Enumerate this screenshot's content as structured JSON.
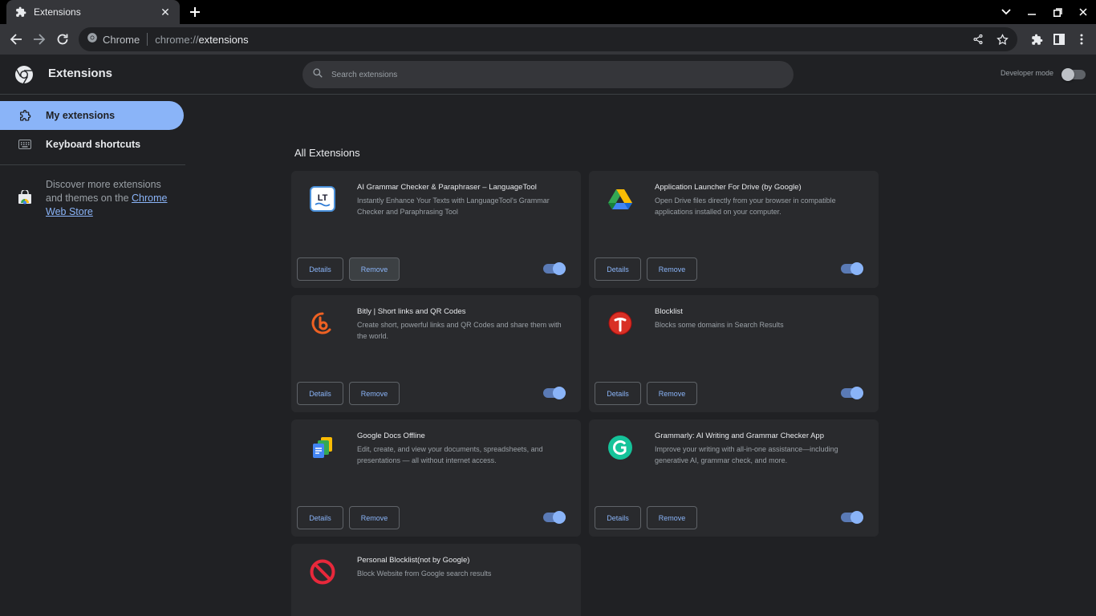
{
  "browser": {
    "tab_title": "Extensions",
    "new_tab_label": "+",
    "site_chip": "Chrome",
    "url_scheme": "chrome://",
    "url_host": "extensions"
  },
  "header": {
    "title": "Extensions",
    "search_placeholder": "Search extensions",
    "developer_mode_label": "Developer mode",
    "developer_mode_on": false
  },
  "sidebar": {
    "items": [
      {
        "label": "My extensions",
        "active": true
      },
      {
        "label": "Keyboard shortcuts",
        "active": false
      }
    ],
    "discover_text_1": "Discover more extensions and themes on the ",
    "discover_link_1": "Chrome",
    "discover_link_2": "Web Store"
  },
  "main": {
    "section_title": "All Extensions",
    "details_label": "Details",
    "remove_label": "Remove",
    "extensions": [
      {
        "name": "AI Grammar Checker & Paraphraser – LanguageTool",
        "description": "Instantly Enhance Your Texts with LanguageTool's Grammar Checker and Paraphrasing Tool",
        "icon": "languagetool-icon",
        "enabled": true
      },
      {
        "name": "Application Launcher For Drive (by Google)",
        "description": "Open Drive files directly from your browser in compatible applications installed on your computer.",
        "icon": "google-drive-icon",
        "enabled": true
      },
      {
        "name": "Bitly | Short links and QR Codes",
        "description": "Create short, powerful links and QR Codes and share them with the world.",
        "icon": "bitly-icon",
        "enabled": true
      },
      {
        "name": "Blocklist",
        "description": "Blocks some domains in Search Results",
        "icon": "blocklist-icon",
        "enabled": true
      },
      {
        "name": "Google Docs Offline",
        "description": "Edit, create, and view your documents, spreadsheets, and presentations — all without internet access.",
        "icon": "google-docs-offline-icon",
        "enabled": true
      },
      {
        "name": "Grammarly: AI Writing and Grammar Checker App",
        "description": "Improve your writing with all-in-one assistance—including generative AI, grammar check, and more.",
        "icon": "grammarly-icon",
        "enabled": true
      },
      {
        "name": "Personal Blocklist(not by Google)",
        "description": "Block Website from Google search results",
        "icon": "prohibited-icon",
        "enabled": true
      }
    ]
  },
  "colors": {
    "accent": "#8ab4f8",
    "background": "#202124",
    "card": "#292a2d"
  }
}
